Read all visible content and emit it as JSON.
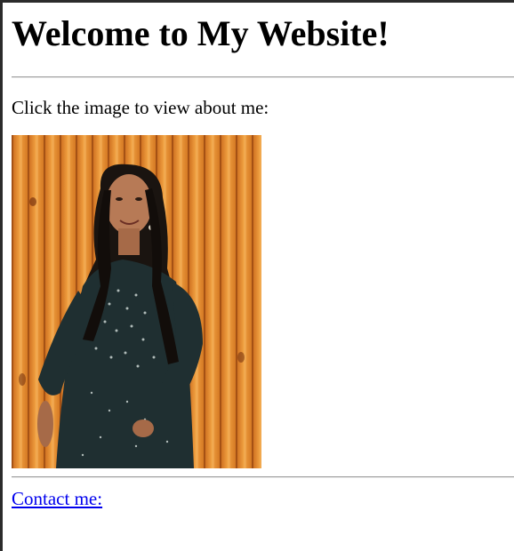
{
  "page": {
    "heading": "Welcome to My Website!",
    "intro_text": "Click the image to view about me:",
    "photo_alt": "photo of a woman standing in front of a wooden wall",
    "contact_link": "Contact me:"
  },
  "colors": {
    "link": "#0000ee",
    "text": "#000000",
    "background": "#ffffff",
    "wall": "#e8902e",
    "dress": "#1f2f31"
  }
}
